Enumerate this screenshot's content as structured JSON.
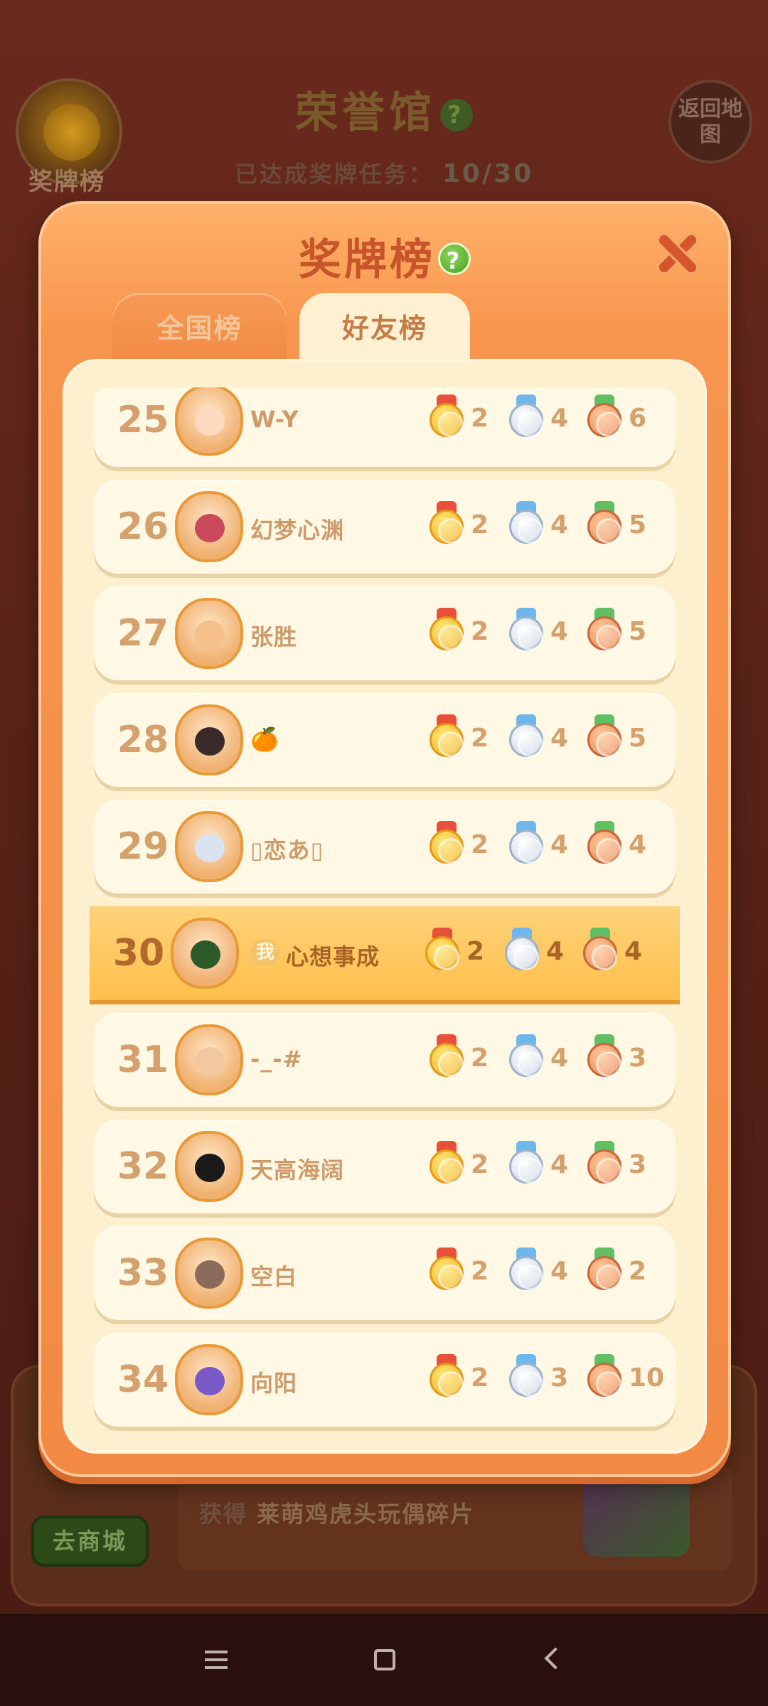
{
  "background": {
    "medal_button_label": "奖牌榜",
    "title": "荣誉馆",
    "progress_label": "已达成奖牌任务：",
    "progress_value": "10/30",
    "return_button": "返回地图",
    "shop_button": "去商城",
    "reward_prefix": "获得",
    "reward_item": "莱萌鸡虎头玩偶碎片"
  },
  "modal": {
    "title": "奖牌榜",
    "help_icon": "?",
    "tabs": [
      {
        "label": "全国榜",
        "active": false
      },
      {
        "label": "好友榜",
        "active": true
      }
    ]
  },
  "colors": {
    "gold": "#f2b01e",
    "silver": "#c7d3e0",
    "bronze": "#e98a52",
    "modal_orange": "#f28a44",
    "highlight_row": "#ffbf4a"
  },
  "rows": [
    {
      "rank": "25",
      "name": "W-Y",
      "gold": "2",
      "silver": "4",
      "bronze": "6"
    },
    {
      "rank": "26",
      "name": "幻梦心渊",
      "gold": "2",
      "silver": "4",
      "bronze": "5"
    },
    {
      "rank": "27",
      "name": "张胜",
      "gold": "2",
      "silver": "4",
      "bronze": "5"
    },
    {
      "rank": "28",
      "name": "🍊",
      "gold": "2",
      "silver": "4",
      "bronze": "5"
    },
    {
      "rank": "29",
      "name": "▯恋あ▯",
      "gold": "2",
      "silver": "4",
      "bronze": "4"
    },
    {
      "rank": "30",
      "name": "心想事成",
      "me_badge": "我",
      "gold": "2",
      "silver": "4",
      "bronze": "4"
    },
    {
      "rank": "31",
      "name": "-_-#",
      "gold": "2",
      "silver": "4",
      "bronze": "3"
    },
    {
      "rank": "32",
      "name": "天高海阔",
      "gold": "2",
      "silver": "4",
      "bronze": "3"
    },
    {
      "rank": "33",
      "name": "空白",
      "gold": "2",
      "silver": "4",
      "bronze": "2"
    },
    {
      "rank": "34",
      "name": "向阳",
      "gold": "2",
      "silver": "3",
      "bronze": "10"
    }
  ]
}
